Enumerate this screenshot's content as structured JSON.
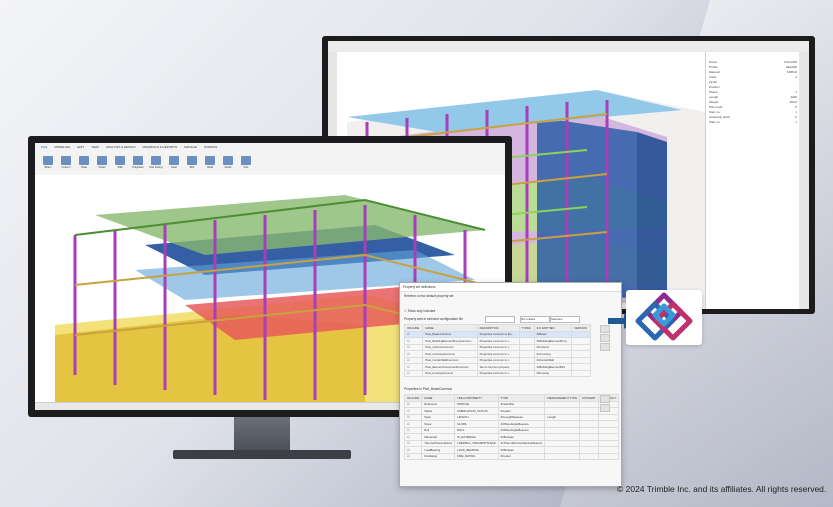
{
  "front_app": {
    "tabs": [
      "FILE",
      "MODELING",
      "EDIT",
      "VIEW",
      "ANALYSIS & DESIGN",
      "DRAWINGS & REPORTS",
      "MANAGE",
      "WINDOW"
    ],
    "ribbon_buttons": [
      "Beam",
      "Column",
      "Plate",
      "Panel",
      "Slab",
      "Polybeam",
      "Pad footing",
      "Steel",
      "Bolt",
      "Weld",
      "Detail",
      "Part"
    ]
  },
  "dialog": {
    "title": "Property set definitions",
    "subtitle": "Retrieve a new default property set",
    "show_only_included": "Show only included",
    "property_sets_label": "Property sets in selected configuration file",
    "filter_entities": "IFC entities",
    "filter_selection": "Selection",
    "top_columns": [
      "INCLUDE",
      "NAME",
      "DESCRIPTION",
      "TYPES",
      "IFC ENTITIES",
      "VERSION"
    ],
    "top_rows": [
      {
        "name": "Pset_BeamCommon",
        "desc": "Properties common to the...",
        "types": "",
        "ent": "IfcBeam",
        "ver": ""
      },
      {
        "name": "Pset_BuildingElementProxyCommon",
        "desc": "Properties common to t...",
        "types": "",
        "ent": "IfcBuildingElementProxy",
        "ver": ""
      },
      {
        "name": "Pset_ColumnCommon",
        "desc": "Properties common to t...",
        "types": "",
        "ent": "IfcColumn",
        "ver": ""
      },
      {
        "name": "Pset_CoveringCommon",
        "desc": "Properties common to t...",
        "types": "",
        "ent": "IfcCovering",
        "ver": ""
      },
      {
        "name": "Pset_CurtainWallCommon",
        "desc": "Properties common to t...",
        "types": "",
        "ent": "IfcCurtainWall",
        "ver": ""
      },
      {
        "name": "Pset_ElementComponentCommon",
        "desc": "Set of common properti...",
        "types": "",
        "ent": "IfcBuildingElementPart",
        "ver": ""
      },
      {
        "name": "Pset_FootingCommon",
        "desc": "Properties common to t...",
        "types": "",
        "ent": "IfcFooting",
        "ver": ""
      }
    ],
    "props_label": "Properties in Pset_BeamCommon",
    "bottom_columns": [
      "INCLUDE",
      "NAME",
      "TEKLA PROPERTY",
      "TYPE",
      "MEASUREMENT TYPE",
      "CONVERT",
      "ACCURACY"
    ],
    "bottom_rows": [
      {
        "name": "Reference",
        "tekla": "PROFILE",
        "type": "IfcIdentifier",
        "meas": "",
        "conv": "",
        "acc": ""
      },
      {
        "name": "Status",
        "tekla": "FABRICATION_STATUS",
        "type": "IfcLabel",
        "meas": "",
        "conv": "",
        "acc": ""
      },
      {
        "name": "Span",
        "tekla": "LENGTH",
        "type": "IfcLengthMeasure",
        "meas": "Length",
        "conv": "",
        "acc": ""
      },
      {
        "name": "Slope",
        "tekla": "SLOPE",
        "type": "IfcPlaneAngleMeasure",
        "meas": "",
        "conv": "",
        "acc": ""
      },
      {
        "name": "Roll",
        "tekla": "ROLL",
        "type": "IfcPlaneAngleMeasure",
        "meas": "",
        "conv": "",
        "acc": ""
      },
      {
        "name": "IsExternal",
        "tekla": "IS_EXTERNAL",
        "type": "IfcBoolean",
        "meas": "",
        "conv": "",
        "acc": ""
      },
      {
        "name": "ThermalTransmittance",
        "tekla": "THERMAL_TRANSMITTANCE",
        "type": "IfcThermalTransmittanceMeasure",
        "meas": "",
        "conv": "",
        "acc": ""
      },
      {
        "name": "LoadBearing",
        "tekla": "LOAD_BEARING",
        "type": "IfcBoolean",
        "meas": "",
        "conv": "",
        "acc": ""
      },
      {
        "name": "FireRating",
        "tekla": "FIRE_RATING",
        "type": "IfcLabel",
        "meas": "",
        "conv": "",
        "acc": ""
      }
    ]
  },
  "back_panel": {
    "rows": [
      {
        "k": "Name",
        "v": "COLUMN"
      },
      {
        "k": "Profile",
        "v": "HEA300"
      },
      {
        "k": "Material",
        "v": "S355J2"
      },
      {
        "k": "Class",
        "v": "2"
      },
      {
        "k": "Finish",
        "v": ""
      },
      {
        "k": "Position",
        "v": ""
      },
      {
        "k": "Phase",
        "v": "1"
      },
      {
        "k": "Length",
        "v": "4200"
      },
      {
        "k": "Weight",
        "v": "369.6"
      },
      {
        "k": "Part prefix",
        "v": "P"
      },
      {
        "k": "Start no.",
        "v": "1"
      },
      {
        "k": "Assembly prefix",
        "v": "C"
      },
      {
        "k": "Start no.",
        "v": "1"
      }
    ]
  },
  "colors": {
    "accent": "#1a5fb4",
    "ifc_icon": "#8b2c8d",
    "arrow": "#1f5a94"
  },
  "copyright": "© 2024 Trimble Inc. and its affiliates. All rights reserved."
}
